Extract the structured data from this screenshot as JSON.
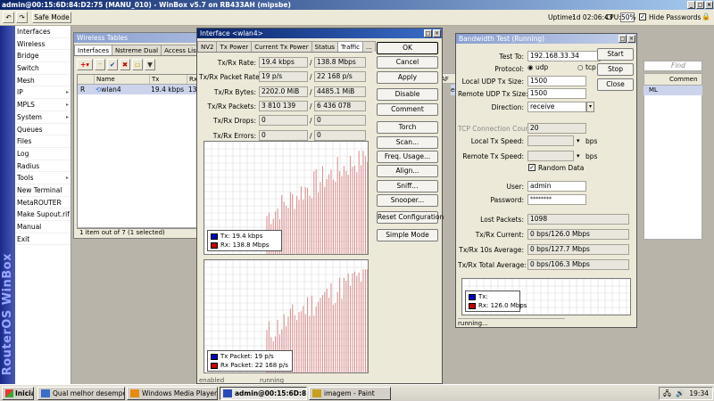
{
  "window": {
    "title": "admin@00:15:6D:84:D2:75 (MANU_010) - WinBox v5.7 on RB433AH (mipsbe)"
  },
  "toolbar": {
    "safe_mode": "Safe Mode",
    "uptime_label": "Uptime:",
    "uptime_value": "1d 02:06:43",
    "cpu_label": "CPU:",
    "cpu_value": "50%",
    "hide_passwords": "Hide Passwords"
  },
  "sidebar_brand": "RouterOS WinBox",
  "menu": [
    {
      "label": "Interfaces",
      "arrow": ""
    },
    {
      "label": "Wireless",
      "arrow": ""
    },
    {
      "label": "Bridge",
      "arrow": ""
    },
    {
      "label": "Switch",
      "arrow": ""
    },
    {
      "label": "Mesh",
      "arrow": ""
    },
    {
      "label": "IP",
      "arrow": "▸"
    },
    {
      "label": "MPLS",
      "arrow": "▸"
    },
    {
      "label": "System",
      "arrow": "▸"
    },
    {
      "label": "Queues",
      "arrow": ""
    },
    {
      "label": "Files",
      "arrow": ""
    },
    {
      "label": "Log",
      "arrow": ""
    },
    {
      "label": "Radius",
      "arrow": ""
    },
    {
      "label": "Tools",
      "arrow": "▸"
    },
    {
      "label": "New Terminal",
      "arrow": ""
    },
    {
      "label": "MetaROUTER",
      "arrow": ""
    },
    {
      "label": "Make Supout.rif",
      "arrow": ""
    },
    {
      "label": "Manual",
      "arrow": ""
    },
    {
      "label": "Exit",
      "arrow": ""
    }
  ],
  "wireless": {
    "title": "Wireless Tables",
    "tabs": [
      "Interfaces",
      "Nstreme Dual",
      "Access List",
      "R"
    ],
    "columns": [
      "Name",
      "Tx",
      "Rx"
    ],
    "row": {
      "flag": "R",
      "name": "wlan4",
      "tx": "19.4 kbps",
      "rx": "13"
    },
    "status": "1 item out of 7 (1 selected)",
    "right_col_a": "AF",
    "right_col_b": "en",
    "right_col_c": "ML",
    "right_comment": "Commen",
    "find": "Find"
  },
  "iface": {
    "title": "Interface <wlan4>",
    "tabs": [
      "NV2",
      "Tx Power",
      "Current Tx Power",
      "Status",
      "Traffic",
      "..."
    ],
    "rows": [
      {
        "label": "Tx/Rx Rate:",
        "a": "19.4 kbps",
        "b": "138.8 Mbps"
      },
      {
        "label": "Tx/Rx Packet Rate:",
        "a": "19 p/s",
        "b": "22 168 p/s"
      },
      {
        "label": "Tx/Rx Bytes:",
        "a": "2202.0 MiB",
        "b": "4485.1 MiB"
      },
      {
        "label": "Tx/Rx Packets:",
        "a": "3 810 139",
        "b": "6 436 078"
      },
      {
        "label": "Tx/Rx Drops:",
        "a": "0",
        "b": "0"
      },
      {
        "label": "Tx/Rx Errors:",
        "a": "0",
        "b": "0"
      }
    ],
    "legend1": {
      "tx": "Tx:   19.4 kbps",
      "rx": "Rx:   138.8 Mbps"
    },
    "legend2": {
      "tx": "Tx Packet:  19 p/s",
      "rx": "Rx Packet:  22 168 p/s"
    },
    "buttons": [
      "OK",
      "Cancel",
      "Apply",
      "Disable",
      "Comment",
      "Torch",
      "Scan...",
      "Freq. Usage...",
      "Align...",
      "Sniff...",
      "Snooper...",
      "Reset Configuration",
      "Simple Mode"
    ],
    "status": "enabled",
    "status2": "running"
  },
  "bw": {
    "title": "Bandwidth Test (Running)",
    "test_to_label": "Test To:",
    "test_to": "192.168.33.34",
    "protocol_label": "Protocol:",
    "udp": "udp",
    "tcp": "tcp",
    "local_udp_label": "Local UDP Tx Size:",
    "local_udp": "1500",
    "remote_udp_label": "Remote UDP Tx Size:",
    "remote_udp": "1500",
    "direction_label": "Direction:",
    "direction": "receive",
    "tcp_conn_label": "TCP Connection Count:",
    "tcp_conn": "20",
    "local_speed_label": "Local Tx Speed:",
    "bps": "bps",
    "remote_speed_label": "Remote Tx Speed:",
    "random_data": "Random Data",
    "user_label": "User:",
    "user": "admin",
    "password_label": "Password:",
    "password": "********",
    "lost_label": "Lost Packets:",
    "lost": "1098",
    "current_label": "Tx/Rx Current:",
    "current": "0 bps/126.0 Mbps",
    "avg10_label": "Tx/Rx 10s Average:",
    "avg10": "0 bps/127.7 Mbps",
    "total_label": "Tx/Rx Total Average:",
    "total": "0 bps/106.3 Mbps",
    "legend_tx": "Tx:",
    "legend_rx": "Rx:   126.0 Mbps",
    "buttons": [
      "Start",
      "Stop",
      "Close"
    ],
    "status": "running..."
  },
  "taskbar": {
    "start": "Iniciar",
    "tasks": [
      "Qual melhor desempenh...",
      "Windows Media Player",
      "admin@00:15:6D:84:D...",
      "imagem - Paint"
    ],
    "clock": "19:34"
  },
  "colors": {
    "tx": "#0000c0",
    "rx": "#c00000",
    "bars": "#d88a8a"
  }
}
